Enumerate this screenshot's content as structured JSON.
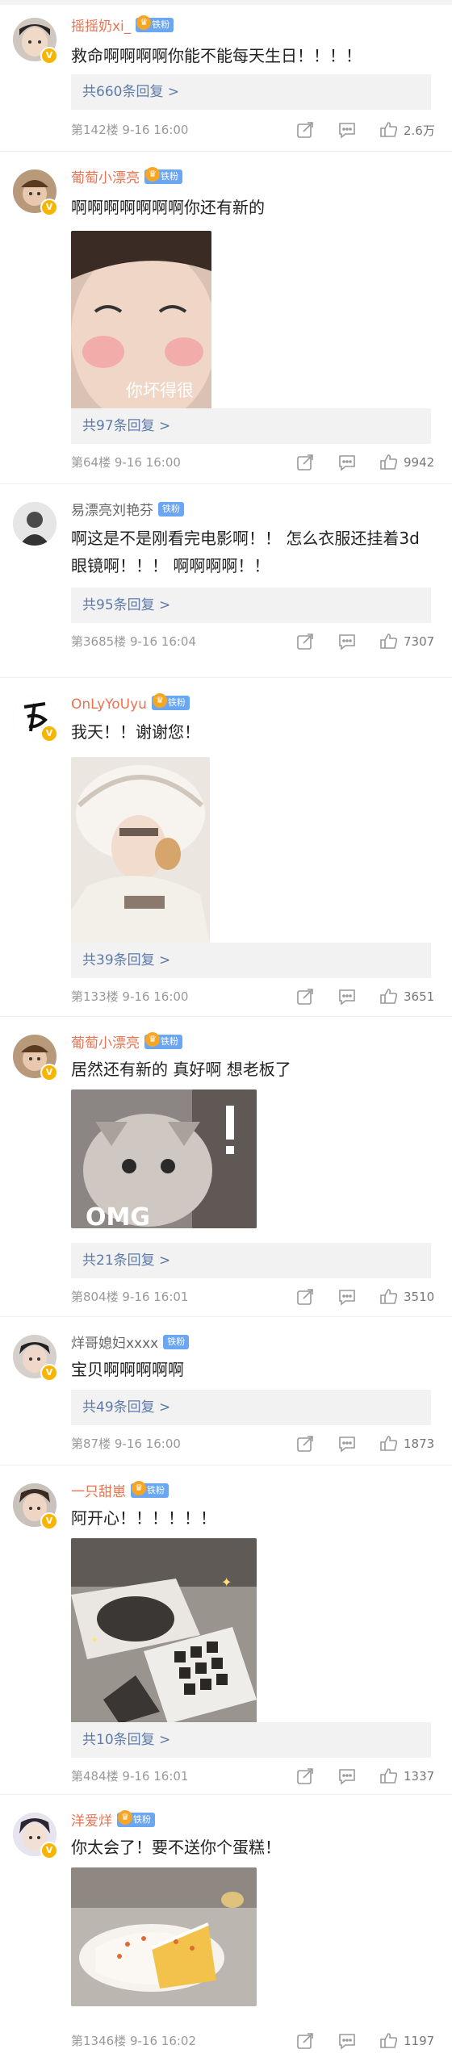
{
  "comments": [
    {
      "name": "摇摇奶xi_",
      "name_color": "orange",
      "badge": "铁粉",
      "text": [
        "救命啊啊啊啊你能不能每天生日！！！！"
      ],
      "replies": "共660条回复 >",
      "floor": "第142楼",
      "time": "9-16 16:00",
      "likes": "2.6万"
    },
    {
      "name": "葡萄小漂亮",
      "name_color": "orange",
      "badge": "铁粉",
      "text": [
        "啊啊啊啊啊啊啊你还有新的"
      ],
      "image_caption": "你坏得很",
      "replies": "共97条回复 >",
      "floor": "第64楼",
      "time": "9-16 16:00",
      "likes": "9942"
    },
    {
      "name": "易漂亮刘艳芬",
      "name_color": "gray",
      "badge": "铁粉",
      "text": [
        "啊这是不是刚看完电影啊！！ 怎么衣服还挂着3d",
        "眼镜啊！！！ 啊啊啊啊！！"
      ],
      "replies": "共95条回复 >",
      "floor": "第3685楼",
      "time": "9-16 16:04",
      "likes": "7307"
    },
    {
      "name": "OnLyYoUyu",
      "name_color": "orange",
      "badge": "铁粉",
      "text": [
        "我天！！谢谢您！"
      ],
      "replies": "共39条回复 >",
      "floor": "第133楼",
      "time": "9-16 16:00",
      "likes": "3651"
    },
    {
      "name": "葡萄小漂亮",
      "name_color": "orange",
      "badge": "铁粉",
      "text": [
        "居然还有新的 真好啊 想老板了"
      ],
      "image_caption": "OMG",
      "replies": "共21条回复 >",
      "floor": "第804楼",
      "time": "9-16 16:01",
      "likes": "3510"
    },
    {
      "name": "烊哥媳妇xxxx",
      "name_color": "gray",
      "badge": "铁粉",
      "text": [
        "宝贝啊啊啊啊啊"
      ],
      "replies": "共49条回复 >",
      "floor": "第87楼",
      "time": "9-16 16:00",
      "likes": "1873"
    },
    {
      "name": "一只甜崽",
      "name_color": "orange",
      "badge": "铁粉",
      "text": [
        "阿开心！！！！！！"
      ],
      "replies": "共10条回复 >",
      "floor": "第484楼",
      "time": "9-16 16:01",
      "likes": "1337"
    },
    {
      "name": "洋爱烊",
      "name_color": "orange",
      "badge": "铁粉",
      "text": [
        "你太会了！要不送你个蛋糕！"
      ],
      "floor": "第1346楼",
      "time": "9-16 16:02",
      "likes": "1197"
    }
  ],
  "icons": {
    "share": "share-icon",
    "comment": "comment-icon",
    "like": "like-icon",
    "verified": "verified-badge-icon",
    "crown": "crown-icon"
  },
  "colors": {
    "username": "#eb7350",
    "replies_link": "#5d7aa8",
    "fan_badge": "#6aa6f2"
  }
}
